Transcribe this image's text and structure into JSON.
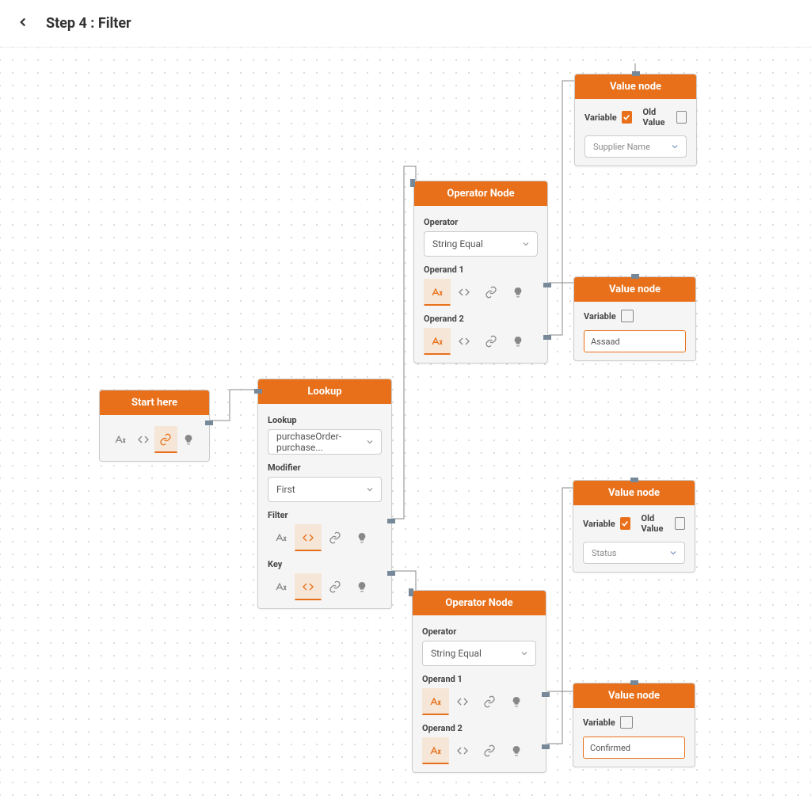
{
  "header": {
    "title": "Step 4 : Filter"
  },
  "nodes": {
    "start": {
      "title": "Start here"
    },
    "lookup": {
      "title": "Lookup",
      "lookup_label": "Lookup",
      "lookup_value": "purchaseOrder-purchase...",
      "modifier_label": "Modifier",
      "modifier_value": "First",
      "filter_label": "Filter",
      "key_label": "Key"
    },
    "op1": {
      "title": "Operator Node",
      "operator_label": "Operator",
      "operator_value": "String Equal",
      "operand1_label": "Operand 1",
      "operand2_label": "Operand 2"
    },
    "op2": {
      "title": "Operator Node",
      "operator_label": "Operator",
      "operator_value": "String Equal",
      "operand1_label": "Operand 1",
      "operand2_label": "Operand 2"
    },
    "val1": {
      "title": "Value node",
      "variable_label": "Variable",
      "oldvalue_label": "Old Value",
      "select_value": "Supplier Name"
    },
    "val2": {
      "title": "Value node",
      "variable_label": "Variable",
      "input_value": "Assaad"
    },
    "val3": {
      "title": "Value node",
      "variable_label": "Variable",
      "oldvalue_label": "Old Value",
      "select_value": "Status"
    },
    "val4": {
      "title": "Value node",
      "variable_label": "Variable",
      "input_value": "Confirmed"
    }
  }
}
